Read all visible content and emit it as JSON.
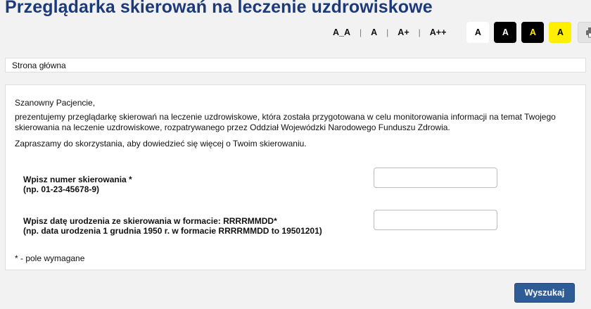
{
  "header": {
    "title": "Przeglądarka skierowań na leczenie uzdrowiskowe"
  },
  "toolbar": {
    "font_sizes": [
      "A_A",
      "A",
      "A+",
      "A++"
    ],
    "contrast_options": [
      "A",
      "A",
      "A",
      "A"
    ],
    "print_icon": "printer-icon",
    "colors": {
      "black": "#000000",
      "yellow": "#ffef00",
      "white": "#ffffff"
    }
  },
  "breadcrumb": {
    "home": "Strona główna"
  },
  "main": {
    "greeting": "Szanowny Pacjencie,",
    "intro": "prezentujemy przeglądarkę skierowań na leczenie uzdrowiskowe, która została przygotowana w celu monitorowania informacji na temat Twojego skierowania na leczenie uzdrowiskowe, rozpatrywanego przez Oddział Wojewódzki Narodowego Funduszu Zdrowia.",
    "invite": "Zapraszamy do skorzystania, aby dowiedzieć się więcej o Twoim skierowaniu.",
    "field_referral": {
      "label": "Wpisz numer skierowania *",
      "hint": "(np. 01-23-45678-9)",
      "value": "",
      "placeholder": ""
    },
    "field_birthdate": {
      "label": "Wpisz datę urodzenia ze skierowania w formacie: RRRRMMDD*",
      "hint": "(np. data urodzenia 1 grudnia 1950 r. w formacie RRRRMMDD to 19501201)",
      "value": "",
      "placeholder": ""
    },
    "required_note": "* - pole wymagane"
  },
  "actions": {
    "search_label": "Wyszukaj",
    "accent_color": "#2e5c96"
  }
}
